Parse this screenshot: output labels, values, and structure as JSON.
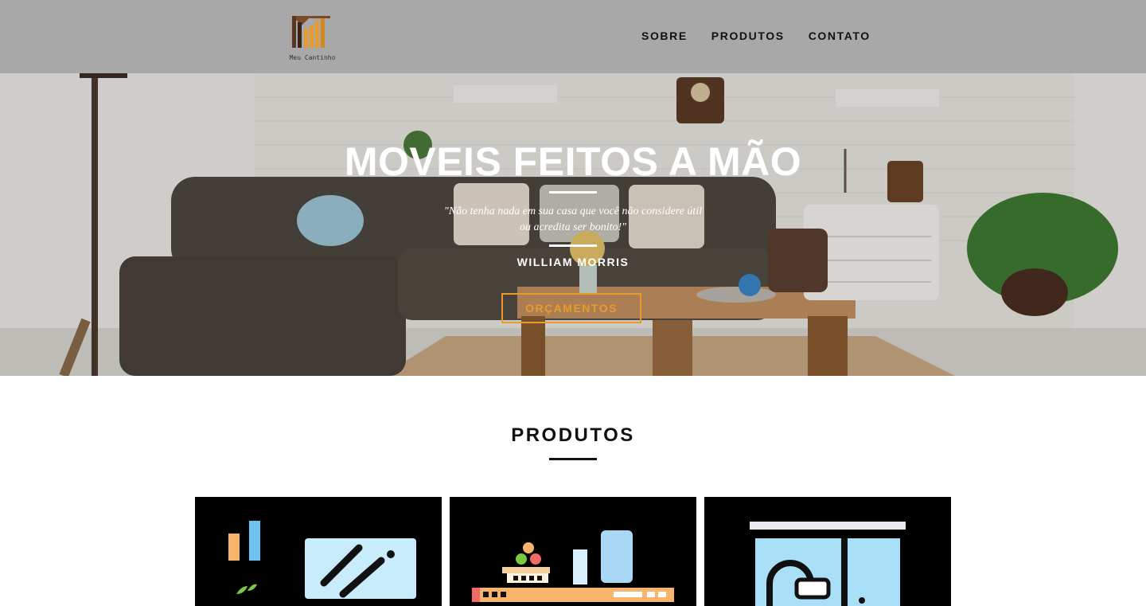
{
  "header": {
    "logo_text": "Meu Cantinho",
    "nav": [
      {
        "label": "SOBRE"
      },
      {
        "label": "PRODUTOS"
      },
      {
        "label": "CONTATO"
      }
    ]
  },
  "hero": {
    "title": "MOVEIS FEITOS A MÃO",
    "quote_line1": "\"Não tenha nada em sua casa que você não considere útil",
    "quote_line2": "ou acredita ser bonito!\"",
    "author": "WILLIAM MORRIS",
    "button_label": "ORÇAMENTOS"
  },
  "products": {
    "title": "PRODUTOS",
    "cards": [
      {
        "icon": "desk-icon"
      },
      {
        "icon": "shelf-icon"
      },
      {
        "icon": "wardrobe-icon"
      }
    ]
  },
  "colors": {
    "header_bg": "#a8a8a8",
    "accent": "#e89a2c",
    "card_bg": "#000000"
  }
}
